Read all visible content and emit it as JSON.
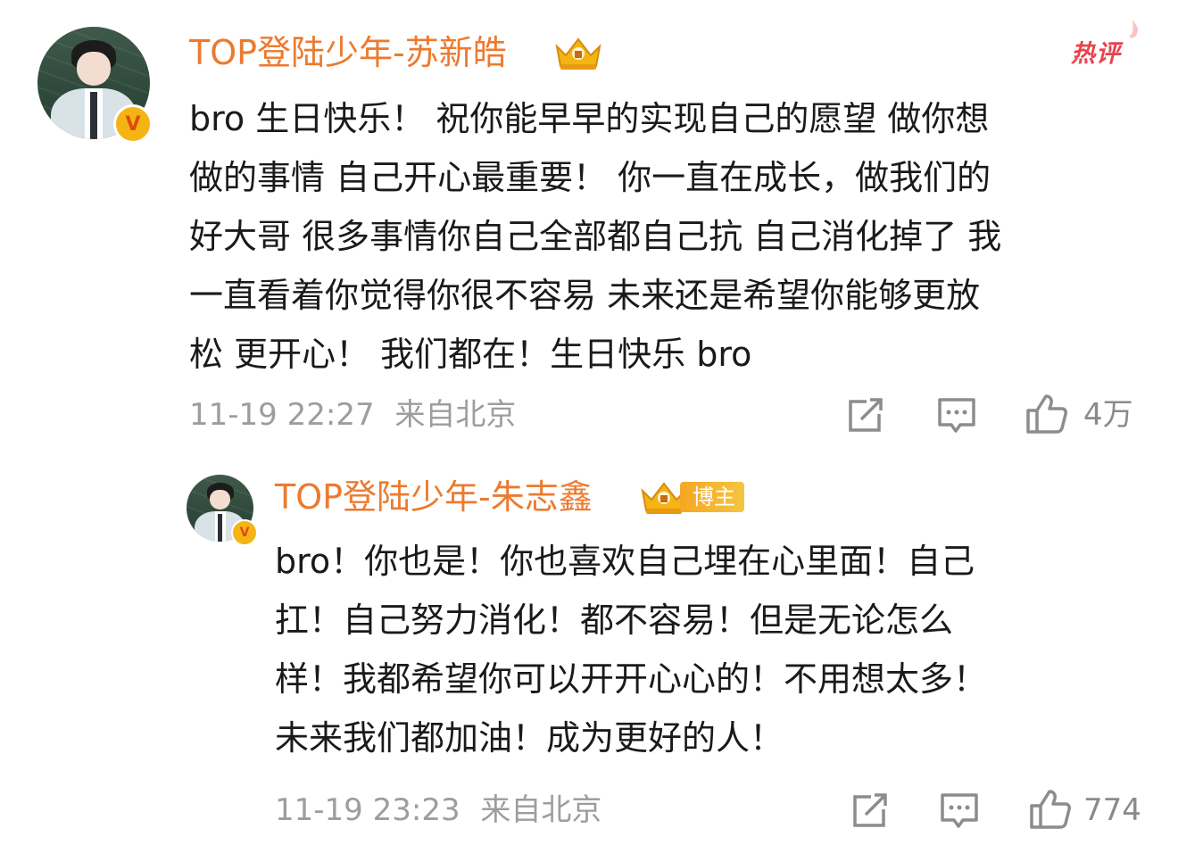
{
  "hot_tag": "热评",
  "main_comment": {
    "username": "TOP登陆少年-苏新皓",
    "verified_badge": "V",
    "content_lines": [
      "bro 生日快乐！ 祝你能早早的实现自己的愿望 做你想",
      "做的事情 自己开心最重要！ 你一直在成长，做我们的",
      "好大哥 很多事情你自己全部都自己抗 自己消化掉了 我",
      "一直看着你觉得你很不容易 未来还是希望你能够更放",
      "松 更开心！ 我们都在！生日快乐 bro"
    ],
    "timestamp": "11-19 22:27",
    "location": "来自北京",
    "like_count": "4万",
    "icons": [
      "share-icon",
      "comment-icon",
      "like-icon"
    ]
  },
  "reply": {
    "username": "TOP登陆少年-朱志鑫",
    "host_badge": "博主",
    "verified_badge": "V",
    "content_lines": [
      "bro！你也是！你也喜欢自己埋在心里面！自己",
      "扛！自己努力消化！都不容易！但是无论怎么",
      "样！我都希望你可以开开心心的！不用想太多！",
      "未来我们都加油！成为更好的人！"
    ],
    "timestamp": "11-19 23:23",
    "location": "来自北京",
    "like_count": "774",
    "icons": [
      "share-icon",
      "comment-icon",
      "like-icon"
    ]
  },
  "colors": {
    "username": "#ec7a2f",
    "hot_tag": "#e8434c",
    "meta_gray": "#9d9d9d",
    "crown_gold": "#f4b514"
  }
}
